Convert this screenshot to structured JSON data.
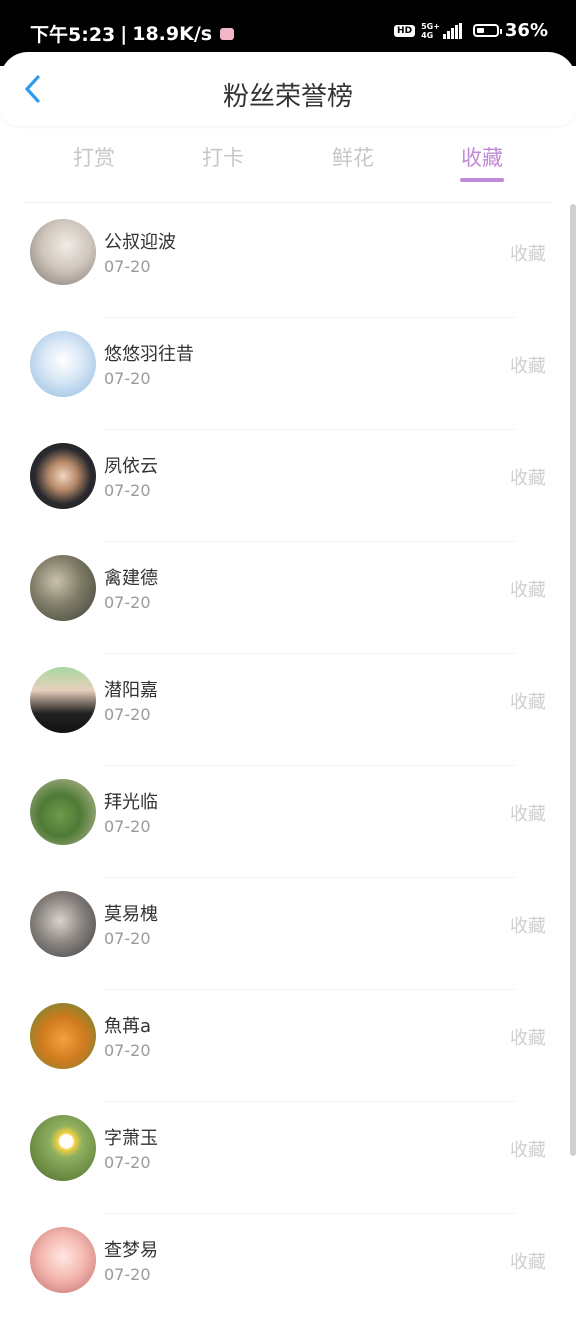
{
  "status_bar": {
    "time": "下午5:23",
    "separator": "|",
    "net_speed": "18.9K/s",
    "hd": "HD",
    "net_type": "5G+",
    "net_sub": "4G",
    "battery": "36%"
  },
  "header": {
    "back_icon": "chevron-left-icon",
    "title": "粉丝荣誉榜"
  },
  "tabs": [
    {
      "label": "打赏",
      "active": false
    },
    {
      "label": "打卡",
      "active": false
    },
    {
      "label": "鲜花",
      "active": false
    },
    {
      "label": "收藏",
      "active": true
    }
  ],
  "accent_color": "#c08ad8",
  "list": [
    {
      "name": "公叔迎波",
      "date": "07-20",
      "action": "收藏"
    },
    {
      "name": "悠悠羽往昔",
      "date": "07-20",
      "action": "收藏"
    },
    {
      "name": "夙依云",
      "date": "07-20",
      "action": "收藏"
    },
    {
      "name": "禽建德",
      "date": "07-20",
      "action": "收藏"
    },
    {
      "name": "潜阳嘉",
      "date": "07-20",
      "action": "收藏"
    },
    {
      "name": "拜光临",
      "date": "07-20",
      "action": "收藏"
    },
    {
      "name": "莫易槐",
      "date": "07-20",
      "action": "收藏"
    },
    {
      "name": "魚苒a",
      "date": "07-20",
      "action": "收藏"
    },
    {
      "name": "字萧玉",
      "date": "07-20",
      "action": "收藏"
    },
    {
      "name": "查梦易",
      "date": "07-20",
      "action": "收藏"
    }
  ]
}
